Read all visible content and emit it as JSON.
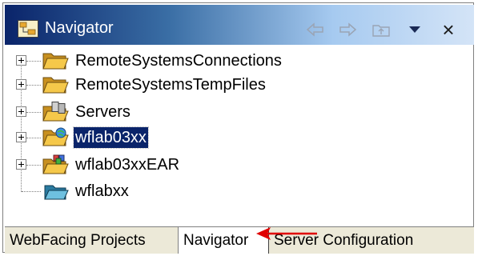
{
  "view": {
    "title": "Navigator",
    "toolbar": {
      "back_icon": "back-arrow-icon",
      "forward_icon": "forward-arrow-icon",
      "up_icon": "up-folder-icon",
      "menu_icon": "view-menu-triangle-icon",
      "close_icon": "close-icon",
      "close_glyph": "×"
    }
  },
  "tree": {
    "items": [
      {
        "label": "RemoteSystemsConnections",
        "expandable": true,
        "icon": "folder-icon",
        "selected": false
      },
      {
        "label": "RemoteSystemsTempFiles",
        "expandable": true,
        "icon": "folder-icon",
        "selected": false
      },
      {
        "label": "Servers",
        "expandable": true,
        "icon": "server-project-folder-icon",
        "selected": false
      },
      {
        "label": "wflab03xx",
        "expandable": true,
        "icon": "web-project-folder-icon",
        "selected": true
      },
      {
        "label": "wflab03xxEAR",
        "expandable": true,
        "icon": "ear-project-folder-icon",
        "selected": false
      },
      {
        "label": "wflabxx",
        "expandable": false,
        "icon": "open-folder-icon",
        "selected": false
      }
    ]
  },
  "tabs": [
    {
      "label": "WebFacing Projects",
      "active": false
    },
    {
      "label": "Navigator",
      "active": true
    },
    {
      "label": "Server Configuration",
      "active": false
    }
  ],
  "colors": {
    "title_gradient_start": "#0a246a",
    "selection": "#0a246a",
    "annotation_arrow": "#e00000"
  }
}
